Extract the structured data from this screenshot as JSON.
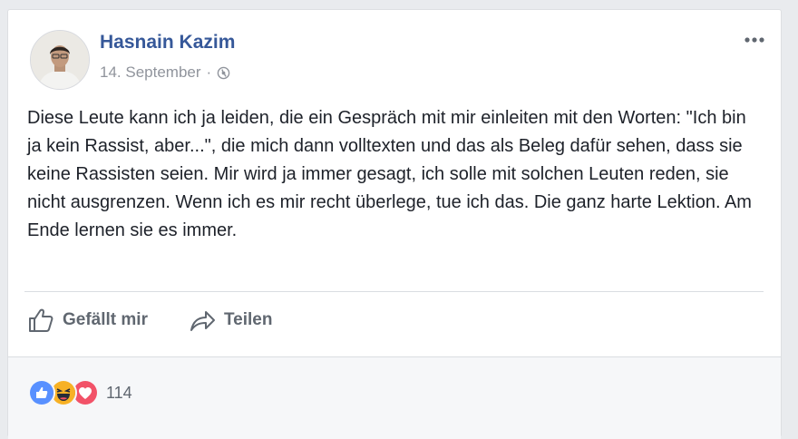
{
  "post": {
    "author": "Hasnain Kazim",
    "date": "14. September",
    "separator": "·",
    "privacy_icon": "globe-icon",
    "more_icon": "more-dots-icon",
    "text": "Diese Leute kann ich ja leiden, die ein Gespräch mit mir einleiten mit den Worten: \"Ich bin ja kein Rassist, aber...\", die mich dann volltexten und das als Beleg dafür sehen, dass sie keine Rassisten seien. Mir wird ja immer gesagt, ich solle mit solchen Leuten reden, sie nicht ausgrenzen. Wenn ich es mir recht überlege, tue ich das. Die ganz harte Lektion. Am Ende lernen sie es immer."
  },
  "actions": {
    "like_label": "Gefällt mir",
    "share_label": "Teilen"
  },
  "reactions": {
    "types": [
      "like",
      "haha",
      "love"
    ],
    "count": "114"
  },
  "colors": {
    "link_blue": "#365899",
    "like_blue": "#5890ff",
    "haha_yellow": "#f7b125",
    "love_red": "#f25268",
    "text": "#1d2129",
    "muted": "#90949c"
  }
}
